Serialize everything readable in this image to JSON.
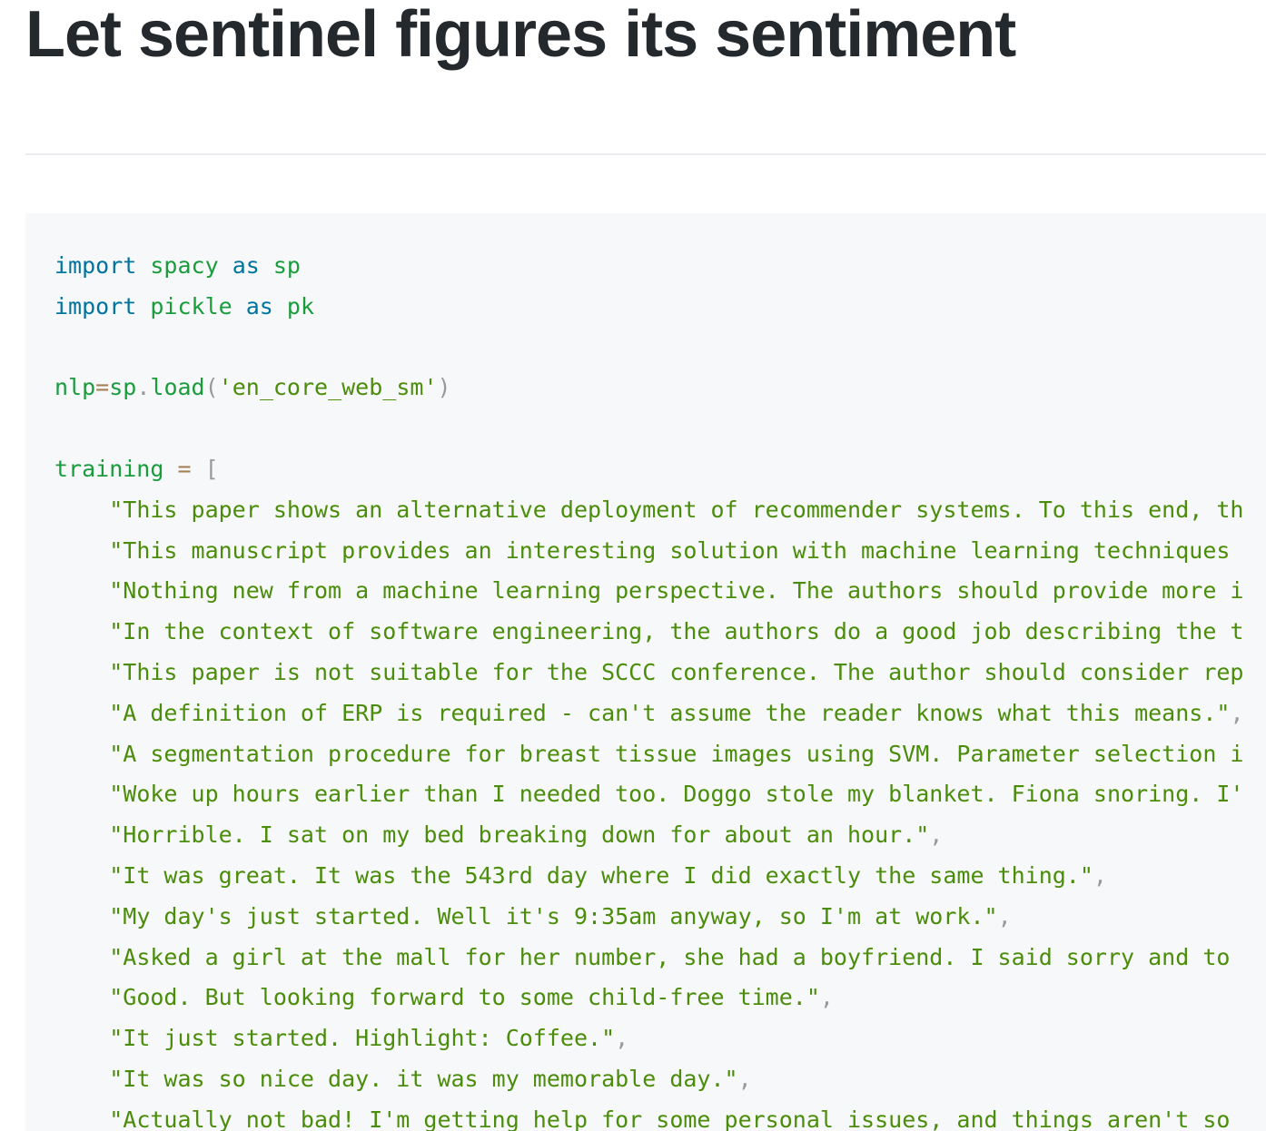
{
  "header": {
    "title": "Let sentinel figures its sentiment"
  },
  "code": {
    "imports": [
      {
        "keyword": "import",
        "module": "spacy",
        "as": "as",
        "alias": "sp"
      },
      {
        "keyword": "import",
        "module": "pickle",
        "as": "as",
        "alias": "pk"
      }
    ],
    "load_line": {
      "var": "nlp",
      "eq": "=",
      "obj": "sp",
      "dot": ".",
      "method": "load",
      "open": "(",
      "arg": "'en_core_web_sm'",
      "close": ")"
    },
    "training_decl": {
      "var": "training",
      "eq": "=",
      "open": "["
    },
    "training_items": [
      "\"This paper shows an alternative deployment of recommender systems. To this end, th",
      "\"This manuscript provides an interesting solution with machine learning techniques ",
      "\"Nothing new from a machine learning perspective. The authors should provide more i",
      "\"In the context of software engineering, the authors do a good job describing the t",
      "\"This paper is not suitable for the SCCC conference. The author should consider rep",
      "\"A definition of ERP is required - can't assume the reader knows what this means.\"",
      "\"A segmentation procedure for breast tissue images using SVM. Parameter selection i",
      "\"Woke up hours earlier than I needed too. Doggo stole my blanket. Fiona snoring. I'",
      "\"Horrible. I sat on my bed breaking down for about an hour.\"",
      "\"It was great. It was the 543rd day where I did exactly the same thing.\"",
      "\"My day's just started. Well it's 9:35am anyway, so I'm at work.\"",
      "\"Asked a girl at the mall for her number, she had a boyfriend. I said sorry and to ",
      "\"Good. But looking forward to some child-free time.\"",
      "\"It just started. Highlight: Coffee.\"",
      "\"It was so nice day. it was my memorable day.\"",
      "\"Actually not bad! I'm getting help for some personal issues, and things aren't so "
    ],
    "item_commas": [
      "",
      "",
      "",
      "",
      "",
      ",",
      "",
      "",
      ",",
      ",",
      ",",
      "",
      ",",
      ",",
      ",",
      ""
    ]
  }
}
